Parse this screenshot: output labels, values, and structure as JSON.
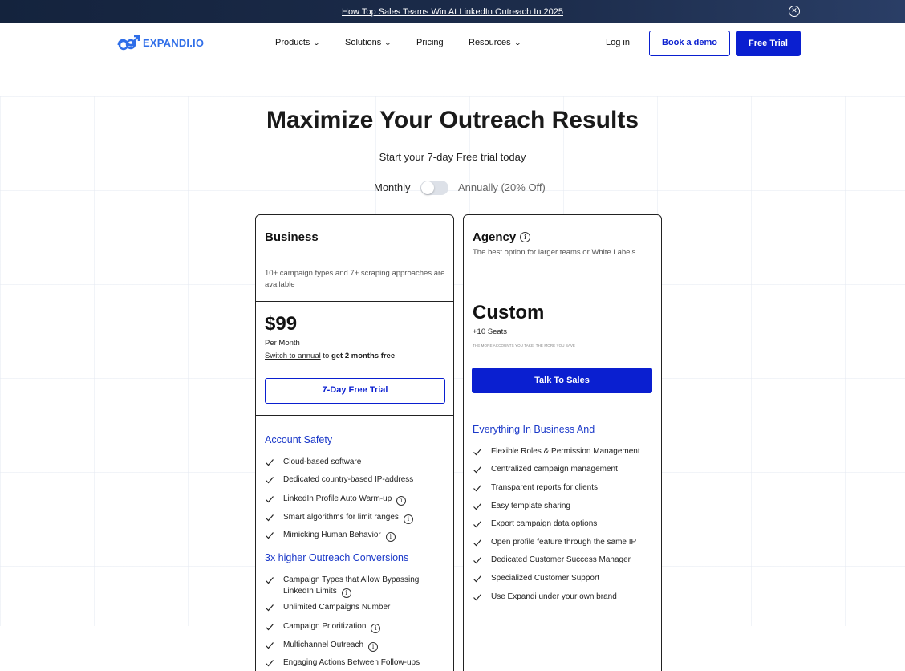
{
  "announcement": {
    "text": "How Top Sales Teams Win At LinkedIn Outreach In 2025",
    "close_icon": "close-icon"
  },
  "nav": {
    "logo_text": "EXPANDI.IO",
    "items": [
      {
        "label": "Products",
        "dropdown": true
      },
      {
        "label": "Solutions",
        "dropdown": true
      },
      {
        "label": "Pricing",
        "dropdown": false
      },
      {
        "label": "Resources",
        "dropdown": true
      }
    ],
    "login": "Log in",
    "book_demo": "Book a demo",
    "free_trial": "Free Trial"
  },
  "hero": {
    "title": "Maximize Your Outreach Results",
    "subtitle": "Start your 7-day Free trial today",
    "toggle": {
      "monthly": "Monthly",
      "annually": "Annually (20% Off)",
      "selected": "Monthly"
    }
  },
  "plans": {
    "business": {
      "name": "Business",
      "description": "10+ campaign types and 7+ scraping approaches are available",
      "price": "$99",
      "period": "Per Month",
      "switch_link": "Switch to annual",
      "switch_to": "to",
      "switch_bold": "get 2 months free",
      "cta": "7-Day Free Trial",
      "sections": [
        {
          "heading": "Account Safety",
          "features": [
            {
              "text": "Cloud-based software",
              "info": false
            },
            {
              "text": "Dedicated country-based IP-address",
              "info": false
            },
            {
              "text": "LinkedIn Profile Auto Warm-up",
              "info": true
            },
            {
              "text": "Smart algorithms for limit ranges",
              "info": true
            },
            {
              "text": "Mimicking Human Behavior",
              "info": true
            }
          ]
        },
        {
          "heading": "3x higher Outreach Conversions",
          "features": [
            {
              "text": "Campaign Types that Allow Bypassing LinkedIn Limits",
              "info": true
            },
            {
              "text": "Unlimited Campaigns Number",
              "info": false
            },
            {
              "text": "Campaign Prioritization",
              "info": true
            },
            {
              "text": "Multichannel Outreach",
              "info": true
            },
            {
              "text": "Engaging Actions Between Follow-ups",
              "info": false
            }
          ]
        }
      ]
    },
    "agency": {
      "name": "Agency",
      "description": "The best option for larger teams or White Labels",
      "price": "Custom",
      "seats": "+10 Seats",
      "tiny_note": "THE MORE ACCOUNTS YOU TAKE, THE MORE YOU SAVE",
      "cta": "Talk To Sales",
      "section_heading": "Everything In Business And",
      "features": [
        "Flexible Roles & Permission Management",
        "Centralized campaign management",
        "Transparent reports for clients",
        "Easy template sharing",
        "Export campaign data options",
        "Open profile feature through the same IP",
        "Dedicated Customer Success Manager",
        "Specialized Customer Support",
        "Use Expandi under your own brand"
      ]
    }
  },
  "colors": {
    "brand_blue": "#0a1fd0",
    "section_blue": "#1b39c9",
    "logo_blue": "#2f6ee8",
    "announce_bg": "#14233d"
  }
}
